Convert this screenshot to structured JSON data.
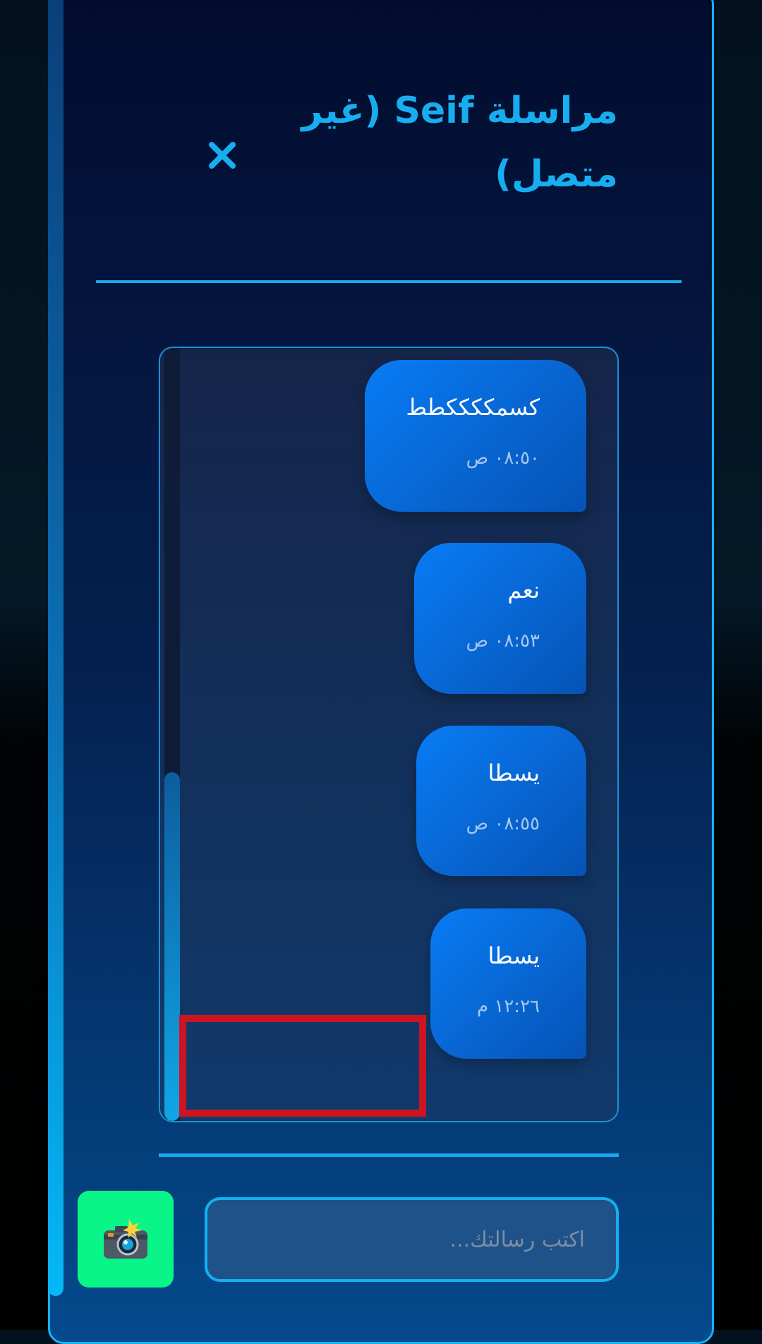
{
  "header": {
    "title": "مراسلة Seif (غير متصل)",
    "close_icon": "close-icon",
    "close_symbol": "✕"
  },
  "messages": [
    {
      "text": "كسمككككطط",
      "time": "٠٨:٥٠ ص"
    },
    {
      "text": "نعم",
      "time": "٠٨:٥٣ ص"
    },
    {
      "text": "يسطا",
      "time": "٠٨:٥٥ ص"
    },
    {
      "text": "يسطا",
      "time": "١٢:٢٦ م"
    }
  ],
  "composer": {
    "placeholder": "اكتب رسالتك...",
    "value": "",
    "camera_icon": "camera-flash-icon",
    "camera_glyph": "📸"
  },
  "colors": {
    "accent": "#13b3f5",
    "bubble": "#097cf5",
    "camera_button": "#0af587",
    "highlight_box": "#cf1421"
  }
}
